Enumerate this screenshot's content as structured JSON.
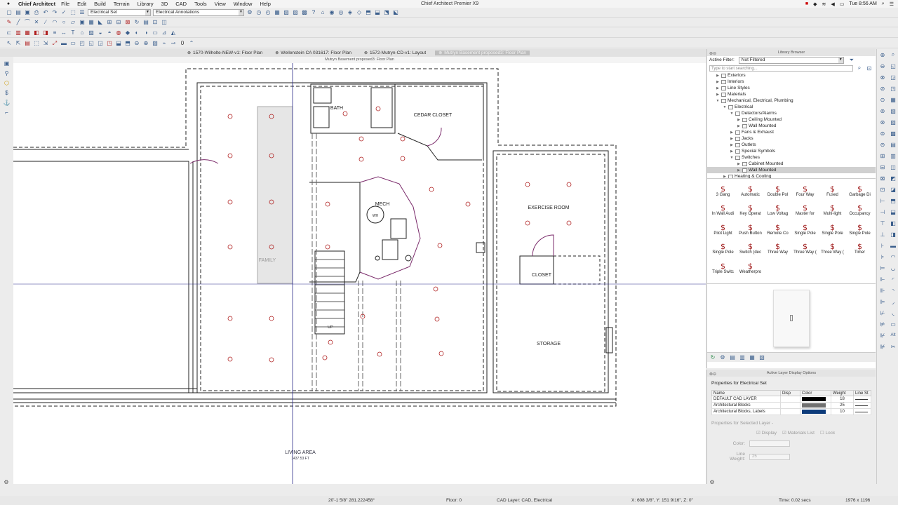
{
  "menubar": {
    "app": "Chief Architect",
    "items": [
      "File",
      "Edit",
      "Build",
      "Terrain",
      "Library",
      "3D",
      "CAD",
      "Tools",
      "View",
      "Window",
      "Help"
    ],
    "window_title": "Chief Architect Premier X9",
    "clock": "Tue 8:56 AM"
  },
  "toolbar": {
    "layer_set": "Electrical Set",
    "annotation_set": "Electrical Annotations",
    "counter": "0"
  },
  "tabs": [
    {
      "label": "1570-Wilholte-NEW-v1: Floor Plan",
      "active": false
    },
    {
      "label": "Wellenstein CA 031617: Floor Plan",
      "active": false
    },
    {
      "label": "1572-Mutryn-CD-v1: Layout",
      "active": false
    },
    {
      "label": "Mutryn Basement proposed3: Floor Plan",
      "active": true
    }
  ],
  "canvas": {
    "title": "Mutryn Basement proposed3: Floor Plan",
    "rooms": {
      "bath": "BATH",
      "cedar": "CEDAR CLOSET",
      "mech": "MECH",
      "wh": "WH",
      "family": "FAMILY",
      "exercise": "EXERCISE ROOM",
      "closet": "CLOSET",
      "storage": "STORAGE",
      "up": "UP",
      "living": "LIVING AREA",
      "living_area": "1437.53 FT"
    }
  },
  "library": {
    "title": "Library Browser",
    "filter_label": "Active Filter:",
    "filter_value": "Not Filtered",
    "search_placeholder": "Type to start searching...",
    "tree": [
      {
        "label": "Exterlors",
        "depth": 0,
        "tw": "▶"
      },
      {
        "label": "Interiors",
        "depth": 0,
        "tw": "▶"
      },
      {
        "label": "Line Styles",
        "depth": 0,
        "tw": "▶"
      },
      {
        "label": "Materials",
        "depth": 0,
        "tw": "▶"
      },
      {
        "label": "Mechanical, Electrical, Plumbing",
        "depth": 0,
        "tw": "▼"
      },
      {
        "label": "Electrical",
        "depth": 1,
        "tw": "▼"
      },
      {
        "label": "Detectors/Alarms",
        "depth": 2,
        "tw": "▼"
      },
      {
        "label": "Ceiling Mounted",
        "depth": 3,
        "tw": "▶"
      },
      {
        "label": "Wall Mounted",
        "depth": 3,
        "tw": "▶"
      },
      {
        "label": "Fans & Exhaust",
        "depth": 2,
        "tw": "▶"
      },
      {
        "label": "Jacks",
        "depth": 2,
        "tw": "▶"
      },
      {
        "label": "Outlets",
        "depth": 2,
        "tw": "▶"
      },
      {
        "label": "Special Symbols",
        "depth": 2,
        "tw": "▶"
      },
      {
        "label": "Switches",
        "depth": 2,
        "tw": "▼"
      },
      {
        "label": "Cabinet Mounted",
        "depth": 3,
        "tw": "▶"
      },
      {
        "label": "Wall Mounted",
        "depth": 3,
        "tw": "▶",
        "selected": true
      },
      {
        "label": "Heating & Cooling",
        "depth": 1,
        "tw": "▶"
      }
    ],
    "items": [
      "3 Gang",
      "Automatic",
      "Double Pol",
      "Four Way",
      "Fused",
      "Garbage Di",
      "In Wall Audi",
      "Key Operat",
      "Low Voltag",
      "Master for",
      "Multi-light",
      "Occupancy",
      "Pilot Light",
      "Push Button",
      "Remote Co",
      "Single Pole",
      "Single Pole",
      "Single Pole",
      "Single Pole",
      "Switch (dec",
      "Three Way",
      "Three Way (",
      "Three Way (",
      "Timer",
      "Triple Switc",
      "Weatherpro"
    ]
  },
  "layers": {
    "title": "Active Layer Display Options",
    "props_title": "Properties for Electrical Set",
    "columns": {
      "name": "Name",
      "disp": "Disp",
      "color": "Color",
      "weight": "Weight",
      "line": "Line St"
    },
    "rows": [
      {
        "name": "DEFAULT CAD LAYER",
        "color": "#000000",
        "weight": "18"
      },
      {
        "name": "Architectural Blocks",
        "color": "#707070",
        "weight": "25"
      },
      {
        "name": "Architectural Blocks, Labels",
        "color": "#0d3b7a",
        "weight": "10"
      }
    ],
    "selected_title": "Properties for Selected Layer -",
    "display": "Display",
    "materials": "Materials List",
    "lock": "Lock",
    "color_label": "Color:",
    "weight_label": "Line Weight:",
    "weight_value": "25"
  },
  "status": {
    "coords": "20'-1 5/8\" 281.222458°",
    "floor": "Floor: 0",
    "cad_layer": "CAD Layer: CAD, Electrical",
    "xyz": "X: 608 3/8\", Y: 151 9/16\", Z: 0\"",
    "time": "Time: 0.02 secs",
    "size": "1976 x 1196"
  }
}
